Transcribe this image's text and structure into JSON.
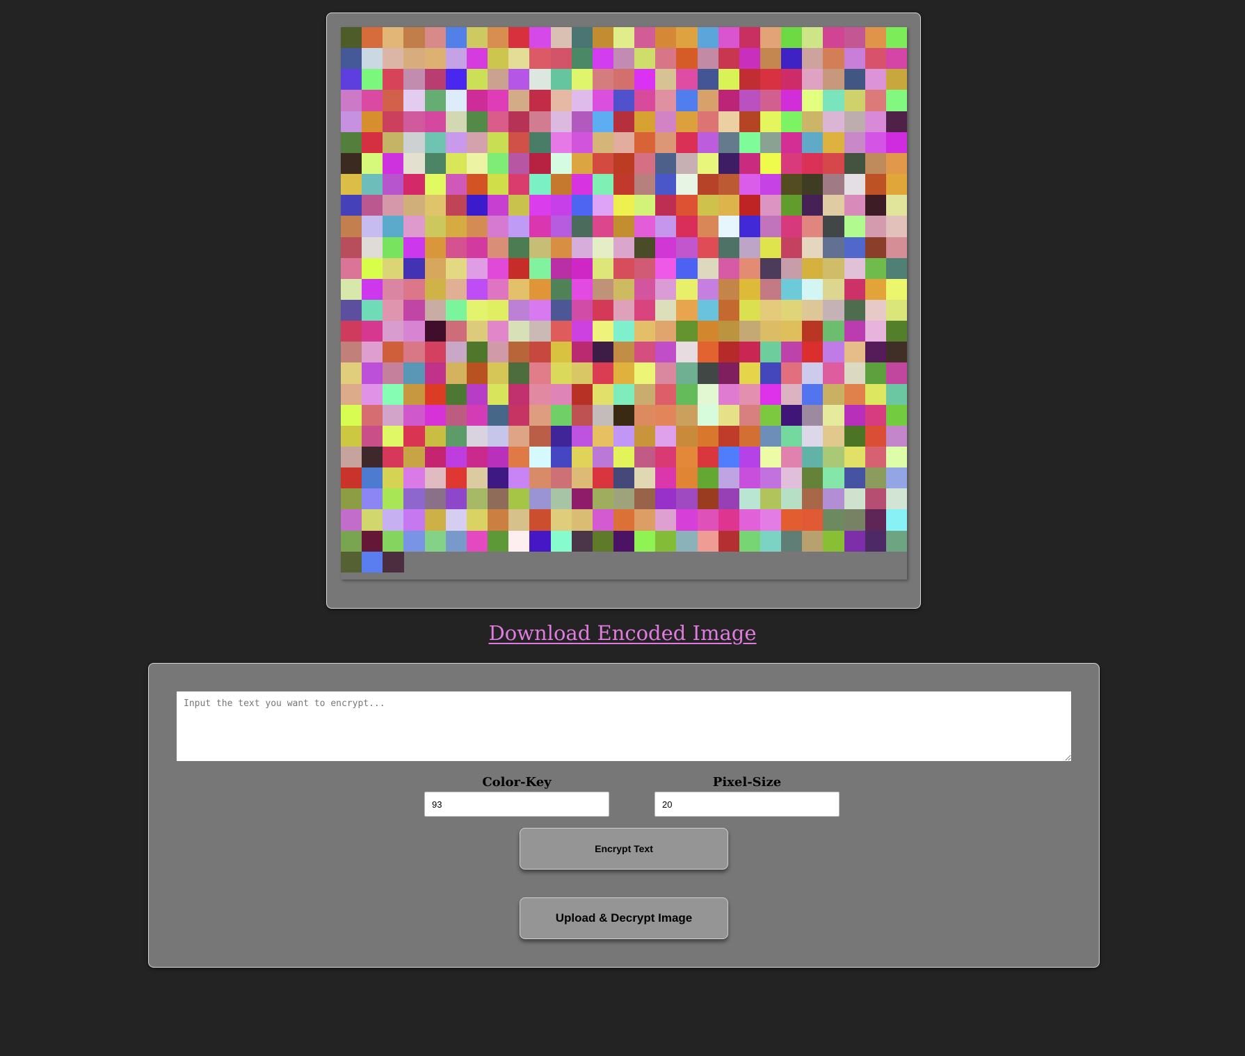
{
  "encoded_image": {
    "columns": 27,
    "colors": [
      "#4d5c28",
      "#d66b3b",
      "#e2b676",
      "#c17e4a",
      "#d8898a",
      "#5080e8",
      "#ceca61",
      "#d78e4e",
      "#d6313d",
      "#d549e8",
      "#d9c0b3",
      "#4b7572",
      "#c28c31",
      "#e1ec8a",
      "#d25c96",
      "#d58936",
      "#dea240",
      "#5ca5db",
      "#d955d0",
      "#c73061",
      "#e2a376",
      "#6dda44",
      "#cde487",
      "#d04493",
      "#c25794",
      "#e09449",
      "#7cec58",
      "#455897",
      "#c9d8e3",
      "#dbb5a6",
      "#d7ad7d",
      "#dcb172",
      "#c5a1e5",
      "#d53bde",
      "#ccc64f",
      "#e4dd98",
      "#dc5a66",
      "#d35368",
      "#4b8866",
      "#d33df0",
      "#c18bb4",
      "#cfde6b",
      "#d87587",
      "#d65c27",
      "#c28aa5",
      "#c8364f",
      "#c92fbd",
      "#c4874f",
      "#3f22c4",
      "#cca39d",
      "#d37e57",
      "#c97fd7",
      "#d9526b",
      "#d545a5",
      "#5c3fde",
      "#7cf77e",
      "#d7445a",
      "#c18cad",
      "#ba3d72",
      "#4a27f0",
      "#cce057",
      "#cba190",
      "#b556e7",
      "#dce8df",
      "#64c59e",
      "#dff56c",
      "#d47c7e",
      "#d36f6d",
      "#db31f2",
      "#d7c293",
      "#df4ca3",
      "#445596",
      "#d9f357",
      "#c02e33",
      "#d8313f",
      "#cd2c68",
      "#dfa2c2",
      "#c8987c",
      "#425684",
      "#dd93d8",
      "#c8a73d",
      "#cc7ac7",
      "#da4aa3",
      "#d2614c",
      "#e2ccef",
      "#65ad72",
      "#dcecfb",
      "#cd2c99",
      "#df3db8",
      "#d4ab87",
      "#c22c47",
      "#e5b9a4",
      "#dfbbeb",
      "#db4fde",
      "#4f51cd",
      "#d84b9c",
      "#df91a1",
      "#507eef",
      "#d8a06b",
      "#bc2478",
      "#b951c0",
      "#d15f90",
      "#d12dd8",
      "#e2ff80",
      "#7ae5bd",
      "#cfd26b",
      "#dc7a7a",
      "#82f880",
      "#c791e2",
      "#d68e2e",
      "#cb415d",
      "#d15a9d",
      "#d4489f",
      "#d2d8b2",
      "#548a47",
      "#da5c8b",
      "#b73355",
      "#d27c92",
      "#dcb9de",
      "#b259be",
      "#5dadf2",
      "#b5303c",
      "#d7a232",
      "#d283c5",
      "#dca13c",
      "#dc7474",
      "#ecd0a1",
      "#b54424",
      "#e4f55d",
      "#7cf362",
      "#ccb468",
      "#dbb5d4",
      "#bdadaf",
      "#d889d8",
      "#502148",
      "#547e3c",
      "#d52f42",
      "#c5b466",
      "#cdd1d1",
      "#6ec4af",
      "#c999eb",
      "#d3a2ac",
      "#cade53",
      "#d05147",
      "#4a7d68",
      "#e779e6",
      "#d054dc",
      "#d6b578",
      "#e2ad9e",
      "#d86337",
      "#dc9777",
      "#da3056",
      "#bc5dde",
      "#657a8d",
      "#80fb9a",
      "#89a292",
      "#d22e94",
      "#60aac7",
      "#ddb23f",
      "#c988c7",
      "#d454e6",
      "#cf2bdf",
      "#3b2a1f",
      "#d6f87b",
      "#cd32de",
      "#e4e0cf",
      "#4c8566",
      "#d8e657",
      "#ecf3a3",
      "#7fec75",
      "#b757a3",
      "#b82242",
      "#d5fce2",
      "#dba641",
      "#d34b40",
      "#bb3b23",
      "#d46f84",
      "#4d6089",
      "#c7b0b4",
      "#e8f67b",
      "#3d1d64",
      "#c92c7e",
      "#eefb4c",
      "#d83a7b",
      "#da3157",
      "#d4474a",
      "#435340",
      "#bf8b5c",
      "#e1984a",
      "#dbbd48",
      "#6dbdba",
      "#b655cc",
      "#d32969",
      "#e1fa61",
      "#cf58b8",
      "#d35325",
      "#cfde49",
      "#da3c6d",
      "#7bf0c5",
      "#c5792e",
      "#d734df",
      "#7fefb3",
      "#c1382c",
      "#b6807d",
      "#4a57c9",
      "#e6f5e4",
      "#b64227",
      "#bc5b33",
      "#d95de9",
      "#c742e4",
      "#534c20",
      "#3e3c23",
      "#a07b86",
      "#e3dfe3",
      "#bd5224",
      "#e0a639",
      "#4542b9",
      "#ba588f",
      "#d498a8",
      "#d1af7a",
      "#e0c46b",
      "#bf4455",
      "#3b1bcb",
      "#c73fd1",
      "#c9c24d",
      "#d93dec",
      "#c73fe8",
      "#4d65f0",
      "#dea2f6",
      "#edf04e",
      "#d2f378",
      "#be2e53",
      "#dc5233",
      "#cfc24c",
      "#ddb44b",
      "#be2424",
      "#dc94c3",
      "#619d2c",
      "#462155",
      "#e0cca3",
      "#d88aba",
      "#3d1c25",
      "#e1e59c",
      "#c3804e",
      "#c7bcef",
      "#5ba9cb",
      "#df9acd",
      "#cdc85d",
      "#d6ab41",
      "#d48c54",
      "#d579d1",
      "#c09bf6",
      "#da36b0",
      "#b55dde",
      "#4b6b5d",
      "#db468c",
      "#c38e2f",
      "#e35dd9",
      "#c696ec",
      "#da2e5a",
      "#da8757",
      "#e7f5fc",
      "#4229d7",
      "#c174bc",
      "#d63a7d",
      "#e0867e",
      "#414646",
      "#b0fa90",
      "#d49aae",
      "#e1c1b9",
      "#b84e5b",
      "#dfdbd6",
      "#77e35e",
      "#cc38ec",
      "#d9963a",
      "#d3528f",
      "#d33aa0",
      "#d98e78",
      "#4c7c52",
      "#c7bd74",
      "#d88f43",
      "#d6aedc",
      "#e5edc6",
      "#dba6cd",
      "#494c26",
      "#d137d4",
      "#c256cd",
      "#df4c56",
      "#4f7266",
      "#bda5c7",
      "#dfe34c",
      "#c4415f",
      "#e5d6bf",
      "#627093",
      "#5067cc",
      "#8b3e2a",
      "#d68e96",
      "#db7597",
      "#d9fe4a",
      "#dbd575",
      "#4233b4",
      "#d6a75c",
      "#e3d983",
      "#df9de6",
      "#e14ad8",
      "#c62c28",
      "#81f29e",
      "#b92fa6",
      "#cf27c5",
      "#dce679",
      "#d64d5b",
      "#d15b74",
      "#ee5ae7",
      "#4c62f2",
      "#ddd9be",
      "#d65ba4",
      "#e38c73",
      "#4c3b5b",
      "#c69da8",
      "#d5b13e",
      "#cfbd6a",
      "#e1c1d7",
      "#6fbb4c",
      "#4e8075",
      "#d8e8aa",
      "#cd38ec",
      "#da86a2",
      "#dc7689",
      "#cfb347",
      "#e1af93",
      "#be4df6",
      "#df75c0",
      "#e4c06b",
      "#e19539",
      "#508258",
      "#e24ae2",
      "#c09278",
      "#cdba61",
      "#d4559f",
      "#db9bd4",
      "#e7f068",
      "#c47fe0",
      "#c48548",
      "#ddba38",
      "#c47a85",
      "#6dcbd9",
      "#d3f5f3",
      "#dcd691",
      "#cc3168",
      "#e2a338",
      "#ebf66d",
      "#5c509e",
      "#70dbb7",
      "#e095ae",
      "#c145a5",
      "#c9aca4",
      "#7bf59c",
      "#e4f36e",
      "#dfef61",
      "#bd80d7",
      "#d77aef",
      "#4e5795",
      "#d04ca6",
      "#d43a57",
      "#dfa1ba",
      "#d9447f",
      "#dbe0bb",
      "#e9a54d",
      "#69c3dd",
      "#c46a31",
      "#dae04f",
      "#e4cb7c",
      "#e0d478",
      "#dec796",
      "#c5b2b6",
      "#4d6d4e",
      "#e7c9c8",
      "#dbe67a",
      "#cf3b5d",
      "#d6378f",
      "#d89dce",
      "#d785d2",
      "#3f0e2a",
      "#ce6d79",
      "#dbcb7b",
      "#e186c8",
      "#d8e0b7",
      "#cbb9b5",
      "#df5c5c",
      "#cc41e0",
      "#eef37c",
      "#7ef0cd",
      "#e3bf69",
      "#e0a56d",
      "#64942f",
      "#d2862e",
      "#bc9440",
      "#c5a975",
      "#dbbd65",
      "#dfbf5c",
      "#b93622",
      "#6dbd6e",
      "#bb3cb1",
      "#e6b4dd",
      "#547f2a",
      "#c1807a",
      "#de9fcf",
      "#cf5e3b",
      "#d87886",
      "#d44060",
      "#c8a7c7",
      "#4e772b",
      "#d19aa9",
      "#b8653a",
      "#c6483f",
      "#d9c23f",
      "#b92a71",
      "#3d1c45",
      "#c28d45",
      "#d44f7f",
      "#c04ec8",
      "#e7dde0",
      "#e26230",
      "#b62a2a",
      "#c92654",
      "#6dcd9c",
      "#bd42aa",
      "#db2f2f",
      "#c17be6",
      "#e6bc88",
      "#561b59",
      "#3f2f27",
      "#e0ce7d",
      "#bd50d9",
      "#c5819c",
      "#5a97b7",
      "#c1328a",
      "#d4b35e",
      "#b95221",
      "#d6c657",
      "#4d6d3e",
      "#e07d88",
      "#dbd95b",
      "#d9c665",
      "#da3d51",
      "#e1b13e",
      "#ecf576",
      "#da889f",
      "#6fb092",
      "#414744",
      "#7f1f5d",
      "#e4d54a",
      "#4446bb",
      "#e16f7e",
      "#cdcbed",
      "#de5d9f",
      "#dbd9c2",
      "#5da03e",
      "#c0479d",
      "#dbab8a",
      "#e092e7",
      "#85fdb3",
      "#c7983f",
      "#dc3c24",
      "#4d7834",
      "#b83dc6",
      "#d6e55c",
      "#c1316e",
      "#e189a1",
      "#df84b7",
      "#b73224",
      "#e0e06a",
      "#7fecbb",
      "#c9ac6e",
      "#dd5e68",
      "#64bb59",
      "#e1f8d3",
      "#e07cd0",
      "#e290ad",
      "#dc33ea",
      "#dcb3c0",
      "#5274ee",
      "#cab062",
      "#e0804b",
      "#dde760",
      "#6bc6a2",
      "#d9fc52",
      "#d56d71",
      "#d2a4c9",
      "#d058cd",
      "#d732d7",
      "#bc5c80",
      "#d33cb5",
      "#466788",
      "#c53462",
      "#df9d80",
      "#70cf66",
      "#be5151",
      "#c4bcba",
      "#3a2913",
      "#dd8a60",
      "#e1865a",
      "#cb9f5c",
      "#d6fcdc",
      "#e6e189",
      "#d8807f",
      "#7cc93f",
      "#3f1578",
      "#9d8aa1",
      "#e6ea9d",
      "#b82fba",
      "#d63c7f",
      "#73cc40",
      "#ccc841",
      "#c94f89",
      "#e0f865",
      "#d93452",
      "#c9bd42",
      "#5b9c68",
      "#d8d3de",
      "#c5c6ea",
      "#dda486",
      "#ba5e48",
      "#3f2598",
      "#bf53e1",
      "#e7c161",
      "#c196f5",
      "#c9953b",
      "#dfa0ec",
      "#c98a3c",
      "#d9782d",
      "#bf3b2a",
      "#d36f32",
      "#6c8eb9",
      "#73d99f",
      "#dcd8e9",
      "#e1c98e",
      "#4c7425",
      "#d94e35",
      "#c386cb",
      "#c7a39d",
      "#3f282c",
      "#d73758",
      "#c7a545",
      "#c52570",
      "#bf3ddf",
      "#c92a8c",
      "#b930bc",
      "#df7a46",
      "#d5f9fc",
      "#4546c2",
      "#dfd35a",
      "#bb78d6",
      "#e2f459",
      "#c25a86",
      "#da3a73",
      "#e28838",
      "#d7373d",
      "#4f7dfb",
      "#b741e9",
      "#ecfba6",
      "#e082ad",
      "#61b2a7",
      "#a9c977",
      "#e0e166",
      "#d66271",
      "#ddfda9",
      "#c9332a",
      "#4c7bd0",
      "#d5d354",
      "#d97ae6",
      "#e0bbc1",
      "#df3731",
      "#dccba1",
      "#3f1983",
      "#c883f4",
      "#d78b67",
      "#ce7176",
      "#ddbb76",
      "#d8353e",
      "#44497a",
      "#e0d8b3",
      "#dc36ad",
      "#e08533",
      "#62a833",
      "#bea4e3",
      "#c84fdc",
      "#c272df",
      "#e2bedd",
      "#648339",
      "#84e6a9",
      "#4653a2",
      "#8b9c5d",
      "#93a5e4",
      "#8d9d43",
      "#8c86f4",
      "#a8e655",
      "#8d66ce",
      "#8b7089",
      "#8e47ca",
      "#a6b967",
      "#8f6c5a",
      "#a6c446",
      "#9b94d4",
      "#a7c5a5",
      "#8e1c69",
      "#9fae5e",
      "#9fa37c",
      "#986348",
      "#9731c7",
      "#9f4ac0",
      "#993c1f",
      "#9740b5",
      "#b8e6d3",
      "#b1c35b",
      "#b7dfc5",
      "#a7684a",
      "#b28fd4",
      "#cfe2cd",
      "#b54e70",
      "#d2e5d4",
      "#c26ccb",
      "#d1d76d",
      "#c7b0f1",
      "#c678f0",
      "#cdb046",
      "#d6cef1",
      "#d9d364",
      "#cb7f40",
      "#d7c18b",
      "#cb4f2e",
      "#dfcd7b",
      "#d9bd72",
      "#d45ad2",
      "#db7137",
      "#dd9e66",
      "#dda0d1",
      "#d640d9",
      "#de51b9",
      "#dd3590",
      "#e061d8",
      "#e47ce6",
      "#e25d30",
      "#e05b35",
      "#6c895f",
      "#768263",
      "#5e2656",
      "#88f1f5",
      "#7aa550",
      "#641737",
      "#85d45f",
      "#7a94e5",
      "#84d188",
      "#7899c9",
      "#e549c2",
      "#5d9936",
      "#fdefef",
      "#4617c4",
      "#86fcce",
      "#4a3549",
      "#5e7a2a",
      "#4c1264",
      "#8ff453",
      "#83bc37",
      "#8bb2b9",
      "#ef9c94",
      "#b42f32",
      "#77d574",
      "#7cd3c3",
      "#5f7f76",
      "#b8a06f",
      "#88bf35",
      "#7d2ea9",
      "#4d2a66",
      "#6fa482",
      "#556132",
      "#5a7ef0",
      "#4c2d3f"
    ]
  },
  "download_link_label": "Download Encoded Image",
  "encrypt_form": {
    "textarea_placeholder": "Input the text you want to encrypt...",
    "textarea_value": "",
    "color_key_label": "Color-Key",
    "color_key_value": "93",
    "pixel_size_label": "Pixel-Size",
    "pixel_size_value": "20",
    "encrypt_button_label": "Encrypt Text",
    "decrypt_button_label": "Upload & Decrypt Image"
  },
  "theme": {
    "page_background": "#232323",
    "panel_background": "#777777",
    "link_color": "#e07be0",
    "button_background": "#959595"
  }
}
